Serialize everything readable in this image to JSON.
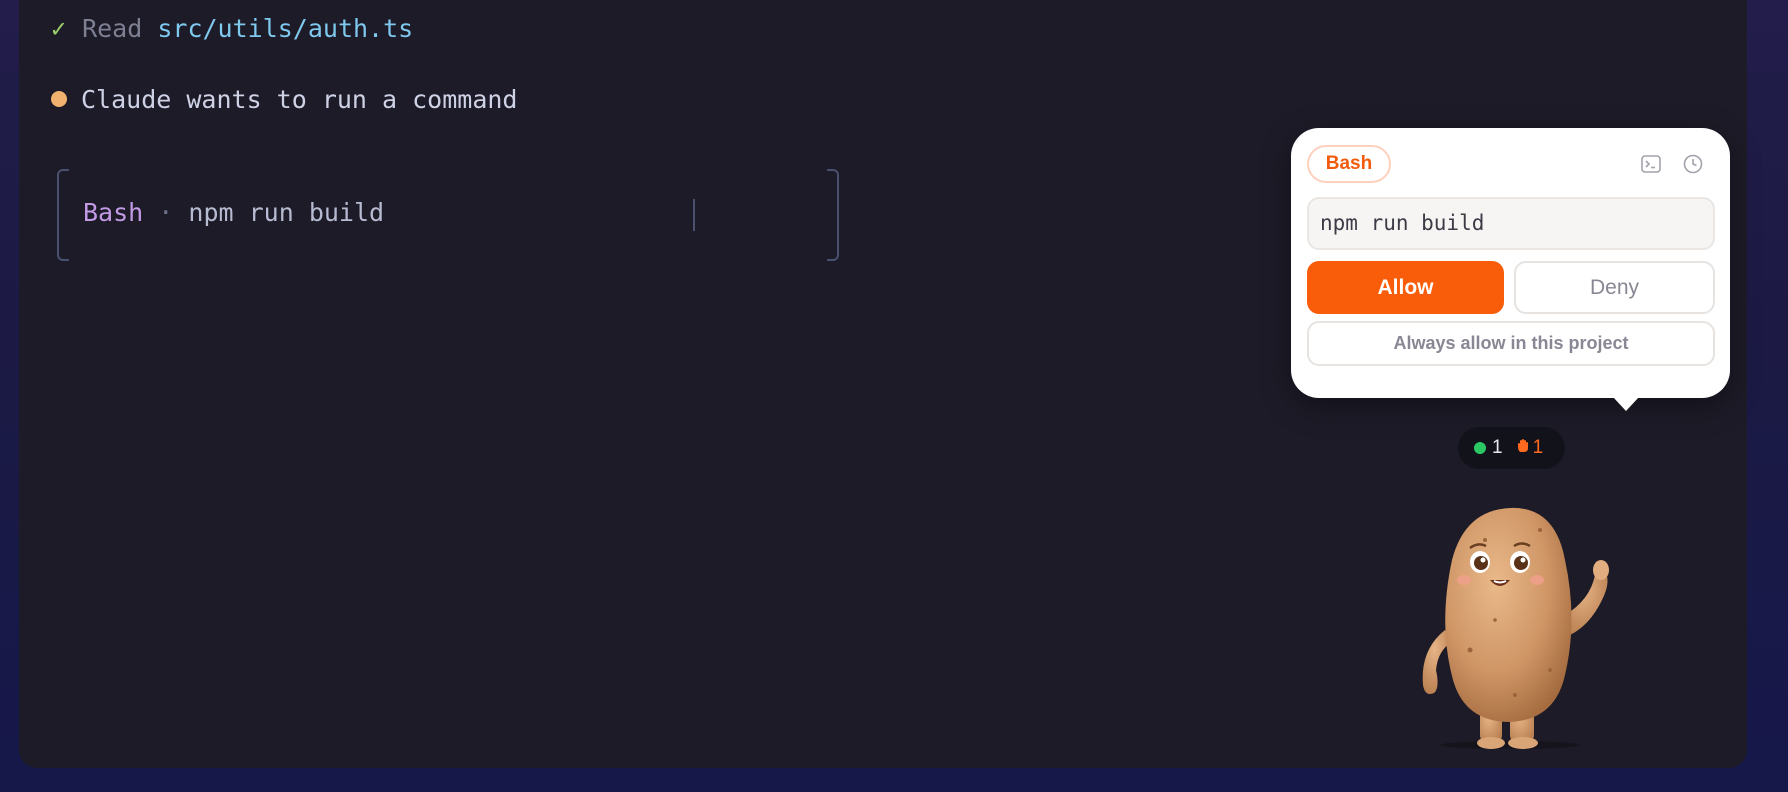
{
  "terminal": {
    "read_line": {
      "check": "✓",
      "verb": "Read",
      "path": "src/utils/auth.ts"
    },
    "prompt_line": {
      "text": "Claude wants to run a command",
      "dot_color": "#f2b26f"
    },
    "command_box": {
      "tool": "Bash",
      "separator": "·",
      "command": "npm run build"
    }
  },
  "permission_popover": {
    "tool_badge": "Bash",
    "icons": [
      "terminal-icon",
      "clock-icon"
    ],
    "command": "npm run build",
    "allow_label": "Allow",
    "deny_label": "Deny",
    "always_allow_label": "Always allow in this project",
    "accent_color": "#fa5d09"
  },
  "status_pill": {
    "active_count": "1",
    "pending_count": "1",
    "active_color": "#2ac863",
    "pending_color": "#ff6a1f"
  },
  "mascot": {
    "icon": "potato-mascot"
  }
}
